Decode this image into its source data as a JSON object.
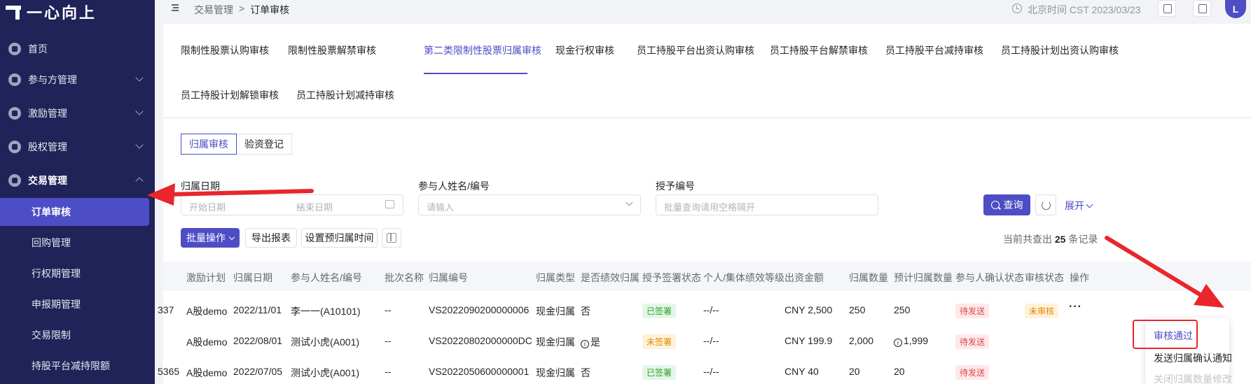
{
  "sidebar": {
    "logo_text": "一心向上",
    "menu": [
      {
        "label": "首页"
      },
      {
        "label": "参与方管理"
      },
      {
        "label": "激励管理"
      },
      {
        "label": "股权管理"
      },
      {
        "label": "交易管理"
      }
    ],
    "submenu": [
      {
        "label": "订单审核"
      },
      {
        "label": "回购管理"
      },
      {
        "label": "行权期管理"
      },
      {
        "label": "申报期管理"
      },
      {
        "label": "交易限制"
      },
      {
        "label": "持股平台减持限额"
      }
    ]
  },
  "topbar": {
    "breadcrumb": [
      "交易管理",
      ">",
      "订单审核"
    ],
    "time_text": "北京时间 CST 2023/03/23",
    "avatar": "L"
  },
  "tabs": [
    {
      "label": "限制性股票认购审核"
    },
    {
      "label": "限制性股票解禁审核"
    },
    {
      "label": "第二类限制性股票归属审核"
    },
    {
      "label": "现金行权审核"
    },
    {
      "label": "员工持股平台出资认购审核"
    },
    {
      "label": "员工持股平台解禁审核"
    },
    {
      "label": "员工持股平台减持审核"
    },
    {
      "label": "员工持股计划出资认购审核"
    },
    {
      "label": "员工持股计划解锁审核"
    },
    {
      "label": "员工持股计划减持审核"
    }
  ],
  "segment": [
    "归属审核",
    "验资登记"
  ],
  "filters": {
    "date_label": "归属日期",
    "date_start": "开始日期",
    "date_arrow": "→",
    "date_end": "结束日期",
    "participant_label": "参与人姓名/编号",
    "participant_placeholder": "请输入",
    "grant_label": "授予编号",
    "grant_placeholder": "批量查询请用空格隔开",
    "query_btn": "查询",
    "expand": "展开"
  },
  "toolbar": {
    "batch": "批量操作",
    "export": "导出报表",
    "set_time": "设置预归属时间",
    "count_prefix": "当前共查出",
    "count": "25",
    "count_suffix": "条记录"
  },
  "table": {
    "headers": [
      "激励计划",
      "归属日期",
      "参与人姓名/编号",
      "批次名称",
      "归属编号",
      "归属类型",
      "是否绩效归属",
      "授予签署状态",
      "个人/集体绩效等级",
      "出资金额",
      "归属数量",
      "预计归属数量",
      "参与人确认状态",
      "审核状态",
      "操作"
    ],
    "rows": [
      {
        "lead": "337",
        "plan": "A股demo",
        "date": "2022/11/01",
        "person": "李一一(A10101)",
        "batch": "--",
        "code": "VS2022090200000006",
        "type": "现金归属",
        "perf": "否",
        "sign": "已签署",
        "level": "--/--",
        "amount": "CNY 2,500",
        "qty": "250",
        "est": "250",
        "confirm": "待发送",
        "audit": "未审核",
        "more": "···"
      },
      {
        "lead": "",
        "plan": "A股demo",
        "date": "2022/08/01",
        "person": "测试小虎(A001)",
        "batch": "--",
        "code": "VS20220802000000DC",
        "type": "现金归属",
        "perf": "是",
        "sign": "未签署",
        "level": "--/--",
        "amount": "CNY 199.9",
        "qty": "2,000",
        "est": "1,999",
        "confirm": "待发送"
      },
      {
        "lead": "5365",
        "plan": "A股demo",
        "date": "2022/07/05",
        "person": "测试小虎(A001)",
        "batch": "--",
        "code": "VS2022050600000001",
        "type": "现金归属",
        "perf": "否",
        "sign": "已签署",
        "level": "--/--",
        "amount": "CNY 40",
        "qty": "20",
        "est": "20",
        "confirm": "待发送"
      }
    ]
  },
  "dropdown": [
    "审核通过",
    "发送归属确认通知",
    "关闭归属数量修改"
  ],
  "colors": {
    "accent": "#4d4dc6",
    "sidebar": "#1f2358",
    "annotation": "#e8262b"
  }
}
